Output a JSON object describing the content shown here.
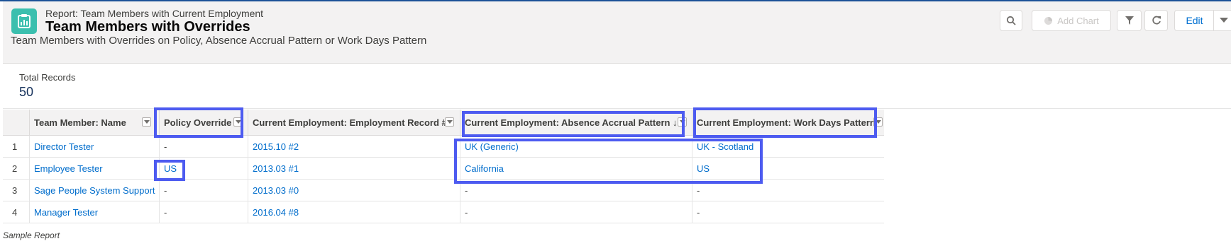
{
  "header": {
    "eyebrow": "Report: Team Members with Current Employment",
    "title": "Team Members with Overrides",
    "description": "Team Members with Overrides on Policy, Absence Accrual Pattern or Work Days Pattern",
    "buttons": {
      "add_chart": "Add Chart",
      "edit": "Edit"
    }
  },
  "summary": {
    "label": "Total Records",
    "value": "50"
  },
  "table": {
    "columns": [
      "Team Member: Name",
      "Policy Override",
      "Current Employment: Employment Record #",
      "Current Employment: Absence Accrual Pattern ↓",
      "Current Employment: Work Days Pattern"
    ],
    "rows": [
      {
        "num": "1",
        "name": "Director Tester",
        "policy": "-",
        "record": "2015.10 #2",
        "accrual": "UK (Generic)",
        "workdays": "UK - Scotland"
      },
      {
        "num": "2",
        "name": "Employee Tester",
        "policy": "US",
        "record": "2013.03 #1",
        "accrual": "California",
        "workdays": "US"
      },
      {
        "num": "3",
        "name": "Sage People System Support",
        "policy": "-",
        "record": "2013.03 #0",
        "accrual": "-",
        "workdays": "-"
      },
      {
        "num": "4",
        "name": "Manager Tester",
        "policy": "-",
        "record": "2016.04 #8",
        "accrual": "-",
        "workdays": "-"
      }
    ]
  },
  "footnote": "Sample Report",
  "colors": {
    "highlight": "#4d5bf0",
    "link": "#006dcc",
    "app_icon": "#3bbfae"
  },
  "icons": [
    "report-icon",
    "search-icon",
    "chart-icon",
    "filter-icon",
    "refresh-icon",
    "chevron-down-icon"
  ]
}
